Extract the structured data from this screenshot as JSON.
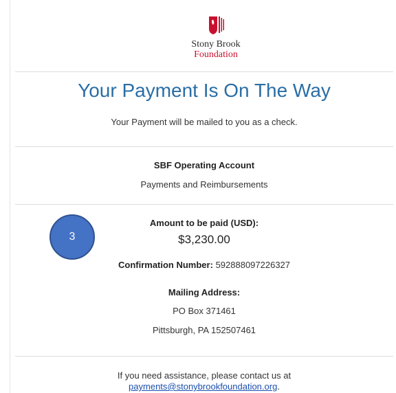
{
  "logo": {
    "line1": "Stony Brook",
    "line2": "Foundation",
    "icon": "shield-torch-icon",
    "brand_color": "#c8102e"
  },
  "heading": {
    "title": "Your Payment Is On The Way",
    "subtitle": "Your Payment will be mailed to you as a check.",
    "title_color": "#2a6ea6"
  },
  "account": {
    "name": "SBF Operating Account",
    "description": "Payments and Reimbursements"
  },
  "payment": {
    "amount_label": "Amount to be paid (USD):",
    "amount_value": "$3,230.00",
    "confirmation_label": "Confirmation Number:",
    "confirmation_value": "592888097226327",
    "mailing_label": "Mailing Address:",
    "mailing_line1": "PO Box 371461",
    "mailing_line2": "Pittsburgh, PA 152507461"
  },
  "help": {
    "text": "If you need assistance, please contact us at",
    "email": "payments@stonybrookfoundation.org",
    "trailing": "."
  },
  "annotation": {
    "label": "3",
    "color": "#4472c4"
  }
}
